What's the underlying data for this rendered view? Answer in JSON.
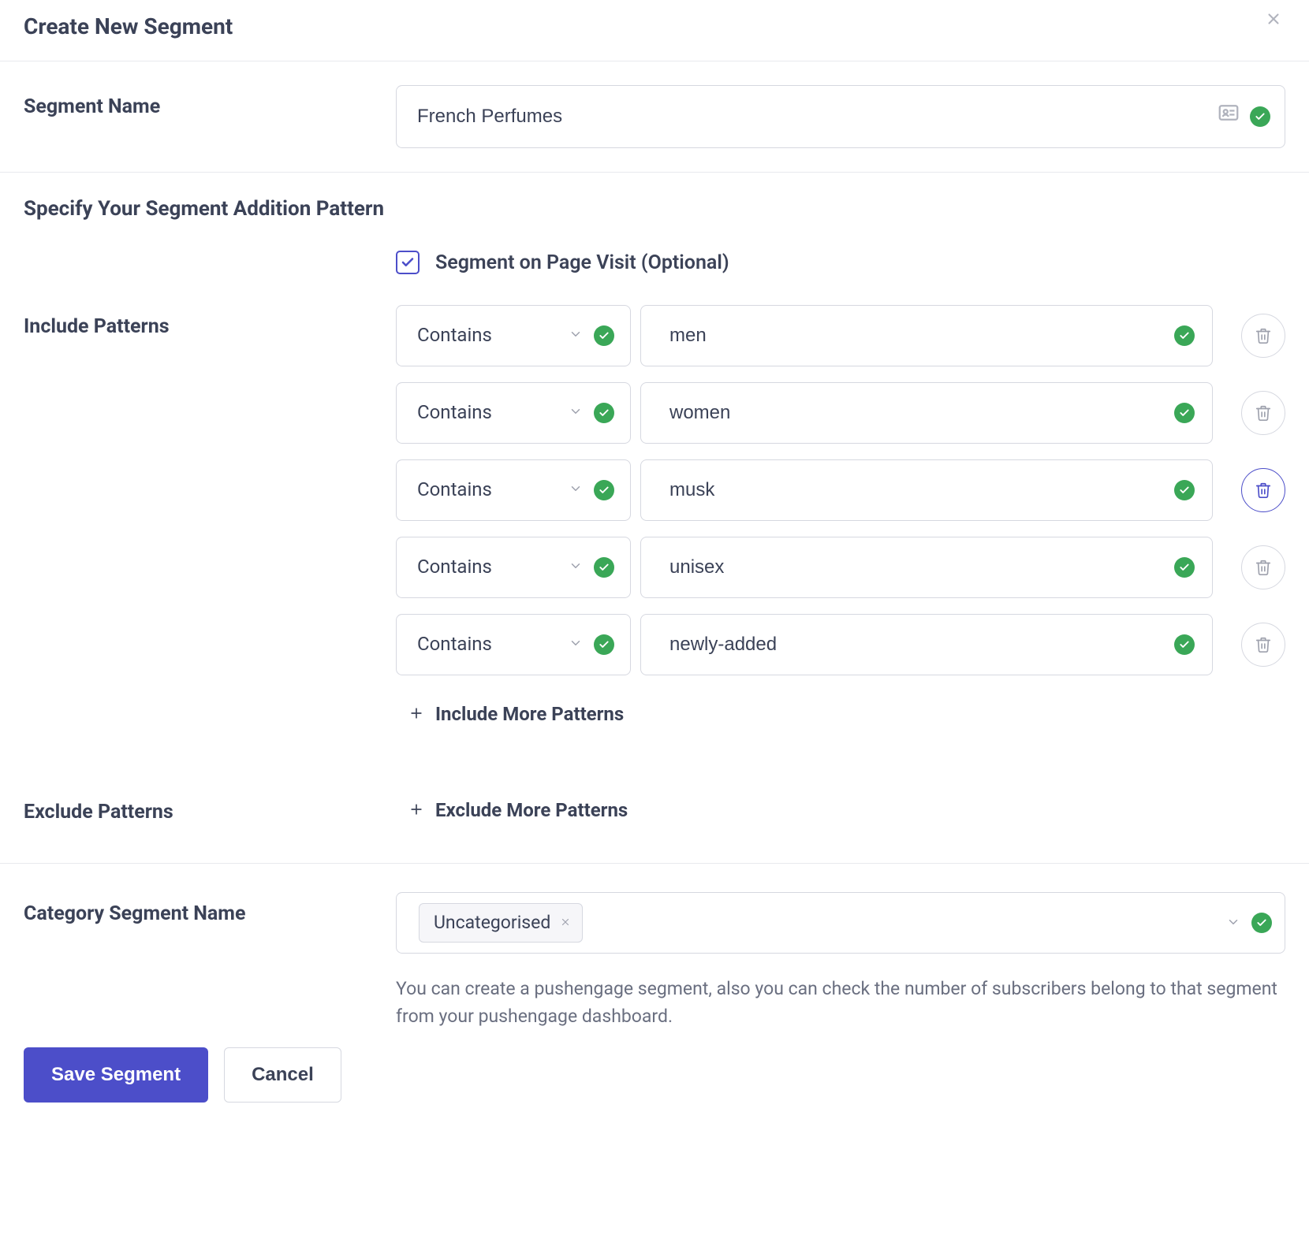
{
  "header": {
    "title": "Create New Segment"
  },
  "segment_name": {
    "label": "Segment Name",
    "value": "French Perfumes"
  },
  "pattern_section": {
    "title": "Specify Your Segment Addition Pattern",
    "checkbox_label": "Segment on Page Visit (Optional)",
    "checkbox_checked": true
  },
  "include": {
    "label": "Include Patterns",
    "add_label": "Include More Patterns",
    "rows": [
      {
        "op": "Contains",
        "value": "men",
        "trash_active": false
      },
      {
        "op": "Contains",
        "value": "women",
        "trash_active": false
      },
      {
        "op": "Contains",
        "value": "musk",
        "trash_active": true
      },
      {
        "op": "Contains",
        "value": "unisex",
        "trash_active": false
      },
      {
        "op": "Contains",
        "value": "newly-added",
        "trash_active": false
      }
    ]
  },
  "exclude": {
    "label": "Exclude Patterns",
    "add_label": "Exclude More Patterns"
  },
  "category": {
    "label": "Category Segment Name",
    "tag": "Uncategorised",
    "helper": "You can create a pushengage segment, also you can check the number of subscribers belong to that segment from your pushengage dashboard."
  },
  "footer": {
    "save": "Save Segment",
    "cancel": "Cancel"
  },
  "colors": {
    "accent": "#4c4ec9",
    "success": "#3aa757"
  }
}
